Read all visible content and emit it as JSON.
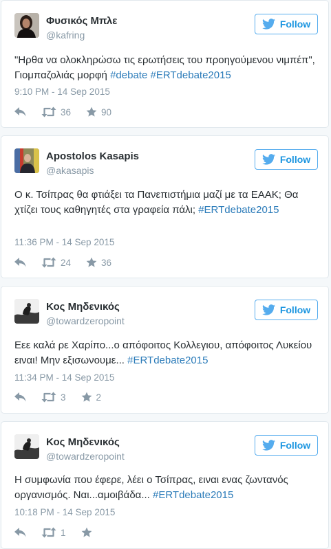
{
  "follow_label": "Follow",
  "colors": {
    "accent": "#55acee",
    "hashtag": "#2b7bb9",
    "meta": "#8899a6",
    "text": "#292f33"
  },
  "tweets": [
    {
      "name": "Φυσικός Μπλε",
      "handle": "@kafring",
      "text_plain": "\"Ηρθα να ολοκληρώσω τις ερωτήσεις του προηγούμενου νιμπέπ\", Γιομπαζολιάς μορφή ",
      "hashtags": [
        "#debate",
        "#ERTdebate2015"
      ],
      "time": "9:10 PM - 14 Sep 2015",
      "retweets": "36",
      "likes": "90"
    },
    {
      "name": "Apostolos Kasapis",
      "handle": "@akasapis",
      "text_plain": "Ο κ. Τσίπρας θα φτιάξει τα Πανεπιστήμια μαζί με τα ΕΑΑΚ; Θα χτίζει τους καθηγητές στα γραφεία πάλι; ",
      "hashtags": [
        "#ERTdebate2015"
      ],
      "time": "11:36 PM - 14 Sep 2015",
      "retweets": "24",
      "likes": "36"
    },
    {
      "name": "Κος Μηδενικός",
      "handle": "@towardzeropoint",
      "text_plain": "Εεε καλά ρε Χαρίπο...ο απόφοιτος Κολλεγιου, απόφοιτος Λυκείου ειναι! Μην εξισωνουμε... ",
      "hashtags": [
        "#ERTdebate2015"
      ],
      "time": "11:34 PM - 14 Sep 2015",
      "retweets": "3",
      "likes": "2"
    },
    {
      "name": "Κος Μηδενικός",
      "handle": "@towardzeropoint",
      "text_plain": "Η συμφωνία που έφερε, λέει ο Τσίπρας, ειναι ενας ζωντανός οργανισμός. Ναι...αμοιβάδα... ",
      "hashtags": [
        "#ERTdebate2015"
      ],
      "time": "10:18 PM - 14 Sep 2015",
      "retweets": "1",
      "likes": ""
    }
  ]
}
